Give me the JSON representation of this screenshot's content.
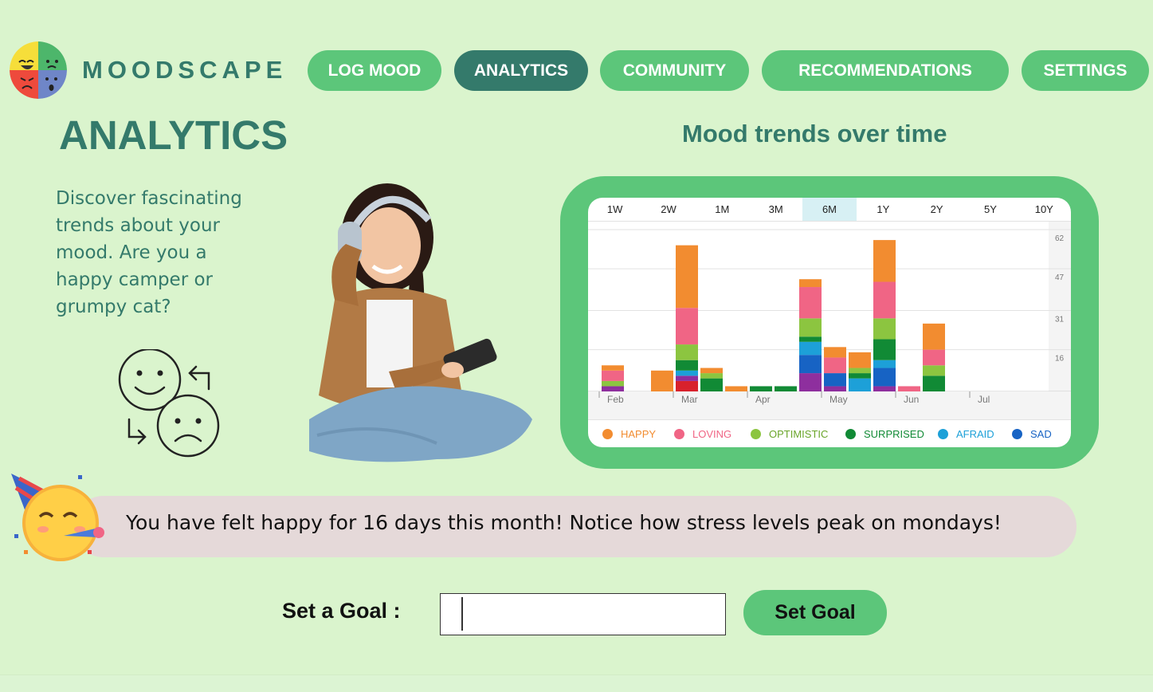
{
  "app": {
    "brand": "MOODSCAPE"
  },
  "nav": [
    {
      "label": "LOG MOOD",
      "active": false
    },
    {
      "label": "ANALYTICS",
      "active": true
    },
    {
      "label": "COMMUNITY",
      "active": false
    },
    {
      "label": "RECOMMENDATIONS",
      "active": false
    },
    {
      "label": "SETTINGS",
      "active": false
    }
  ],
  "page": {
    "title": "ANALYTICS",
    "intro": "Discover fascinating trends about your mood. Are you a happy camper or grumpy cat?"
  },
  "chart_section": {
    "title": "Mood trends over time",
    "range_tabs": [
      "1W",
      "2W",
      "1M",
      "3M",
      "6M",
      "1Y",
      "2Y",
      "5Y",
      "10Y"
    ],
    "active_range": "6M"
  },
  "chart_data": {
    "type": "bar",
    "stacked": true,
    "title": "",
    "xlabel": "",
    "ylabel": "",
    "ylim": [
      0,
      62
    ],
    "y_ticks": [
      16,
      31,
      47,
      62
    ],
    "x_tick_labels": [
      "Feb",
      "Mar",
      "Apr",
      "May",
      "Jun",
      "Jul"
    ],
    "grid": true,
    "legend_position": "bottom",
    "series": [
      {
        "name": "HAPPY",
        "color": "#f28c30",
        "values": [
          2,
          0,
          8,
          24,
          2,
          2,
          0,
          0,
          3,
          4,
          6,
          16,
          0,
          10
        ]
      },
      {
        "name": "LOVING",
        "color": "#f06585",
        "values": [
          4,
          0,
          0,
          14,
          0,
          0,
          0,
          0,
          12,
          6,
          0,
          14,
          2,
          6
        ]
      },
      {
        "name": "OPTIMISTIC",
        "color": "#8cc540",
        "values": [
          2,
          0,
          0,
          6,
          2,
          0,
          0,
          0,
          7,
          0,
          2,
          8,
          0,
          4
        ]
      },
      {
        "name": "SURPRISED",
        "color": "#118a35",
        "values": [
          0,
          0,
          0,
          4,
          5,
          0,
          2,
          2,
          2,
          0,
          2,
          8,
          0,
          6
        ]
      },
      {
        "name": "AFRAID",
        "color": "#1da0d8",
        "values": [
          0,
          0,
          0,
          2,
          0,
          0,
          0,
          0,
          5,
          0,
          5,
          3,
          0,
          0
        ]
      },
      {
        "name": "SAD",
        "color": "#1763c4",
        "values": [
          0,
          0,
          0,
          0,
          0,
          0,
          0,
          0,
          7,
          5,
          0,
          7,
          0,
          0
        ]
      },
      {
        "name": "",
        "color": "#8e2f9e",
        "values": [
          2,
          0,
          0,
          2,
          0,
          0,
          0,
          0,
          7,
          2,
          0,
          2,
          0,
          0
        ]
      },
      {
        "name": "",
        "color": "#d8212c",
        "values": [
          0,
          0,
          0,
          4,
          0,
          0,
          0,
          0,
          0,
          0,
          0,
          0,
          0,
          0
        ]
      }
    ]
  },
  "banner": {
    "message": "You have felt happy for 16 days this month! Notice how stress levels peak on mondays!"
  },
  "goal": {
    "label": "Set a Goal :",
    "input_value": "",
    "button_label": "Set Goal"
  },
  "icons": {
    "logo": "mood-faces-logo-icon",
    "swap": "smile-frown-swap-icon",
    "party": "party-face-emoji-icon"
  }
}
